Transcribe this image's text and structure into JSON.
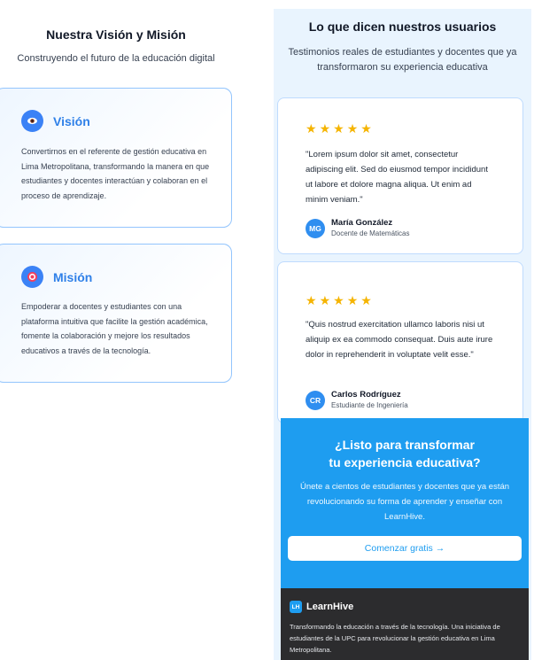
{
  "vision_mission": {
    "title": "Nuestra Visión y Misión",
    "subtitle": "Construyendo el futuro de la educación digital",
    "cards": [
      {
        "icon": "eye-icon",
        "title": "Visión",
        "text": "Convertirnos en el referente de gestión educativa en Lima Metropolitana, transformando la manera en que estudiantes y docentes interactúan y colaboran en el proceso de aprendizaje."
      },
      {
        "icon": "target-icon",
        "title": "Misión",
        "text": "Empoderar a docentes y estudiantes con una plataforma intuitiva que facilite la gestión académica, fomente la colaboración y mejore los resultados educativos a través de la tecnología."
      }
    ]
  },
  "testimonials": {
    "title": "Lo que dicen nuestros usuarios",
    "subtitle": "Testimonios reales de estudiantes y docentes que ya transformaron su experiencia educativa",
    "items": [
      {
        "rating": 5,
        "quote": "\"Lorem ipsum dolor sit amet, consectetur adipiscing elit. Sed do eiusmod tempor incididunt ut labore et dolore magna aliqua. Ut enim ad minim veniam.\"",
        "initials": "MG",
        "name": "María González",
        "role": "Docente de Matemáticas"
      },
      {
        "rating": 5,
        "quote": "\"Quis nostrud exercitation ullamco laboris nisi ut aliquip ex ea commodo consequat. Duis aute irure dolor in reprehenderit in voluptate velit esse.\"",
        "initials": "CR",
        "name": "Carlos Rodríguez",
        "role": "Estudiante de Ingeniería"
      }
    ]
  },
  "cta": {
    "title_line1": "¿Listo para transformar",
    "title_line2": "tu experiencia educativa?",
    "text": "Únete a cientos de estudiantes y docentes que ya están revolucionando su forma de aprender y enseñar con LearnHive.",
    "button_label": "Comenzar gratis →"
  },
  "footer": {
    "logo_initials": "LH",
    "brand": "LearnHive",
    "text": "Transformando la educación a través de la tecnología. Una iniciativa de estudiantes de la UPC para revolucionar la gestión educativa en Lima Metropolitana."
  },
  "colors": {
    "accent": "#2f80e8",
    "cta_background": "#1e9df0",
    "star": "#f5b400",
    "footer_background": "#2c2c2e"
  }
}
